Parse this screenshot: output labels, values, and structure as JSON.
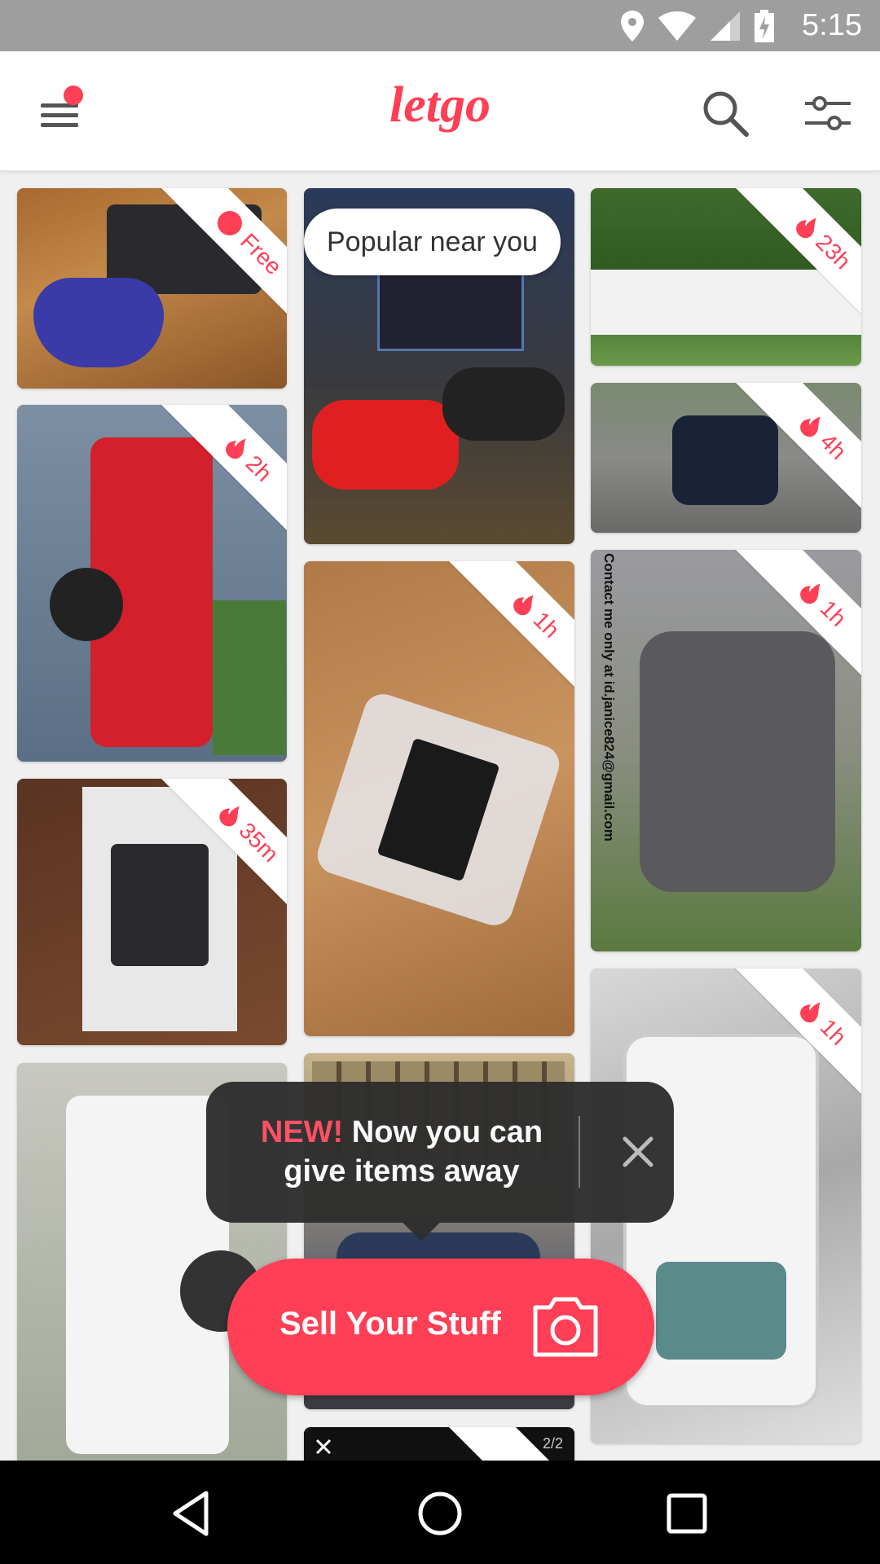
{
  "status_bar": {
    "time": "5:15",
    "icons": [
      "location-icon",
      "wifi-icon",
      "signal-icon",
      "battery-charging-icon"
    ],
    "background": "#9e9e9e"
  },
  "app_bar": {
    "logo_text": "letgo",
    "brand_color": "#ff3f55",
    "menu_has_notification": true
  },
  "popular_label": "Popular near you",
  "listings": [
    {
      "badge": "Free",
      "badge_type": "free",
      "photo": "n64-console-controller"
    },
    {
      "badge": "",
      "badge_type": "none",
      "photo": "ps4-games-controllers"
    },
    {
      "badge": "23h",
      "badge_type": "time",
      "photo": "white-fence"
    },
    {
      "badge": "4h",
      "badge_type": "time",
      "photo": "dark-blue-car-parking"
    },
    {
      "badge": "2h",
      "badge_type": "time",
      "photo": "red-pickup-truck"
    },
    {
      "badge": "1h",
      "badge_type": "time",
      "photo": "microsd-card-adapter"
    },
    {
      "badge": "1h",
      "badge_type": "time",
      "photo": "gray-toyota-sedan",
      "overlay_text": "Contact me only at id.janice824@gmail.com"
    },
    {
      "badge": "35m",
      "badge_type": "time",
      "photo": "nintendo-switch-box"
    },
    {
      "badge": "1h",
      "badge_type": "time",
      "photo": "htc-phone"
    },
    {
      "badge": "",
      "badge_type": "none",
      "photo": "white-pickup-truck"
    },
    {
      "badge": "",
      "badge_type": "none",
      "photo": "building-street-car"
    },
    {
      "badge": "",
      "badge_type": "none",
      "photo": "video-card",
      "counter": "2/2"
    }
  ],
  "tooltip": {
    "new_label": "NEW!",
    "message": " Now you can give items away"
  },
  "sell_button": {
    "label": "Sell Your Stuff"
  },
  "nav_bar": {
    "buttons": [
      "back-icon",
      "home-icon",
      "recents-icon"
    ]
  }
}
